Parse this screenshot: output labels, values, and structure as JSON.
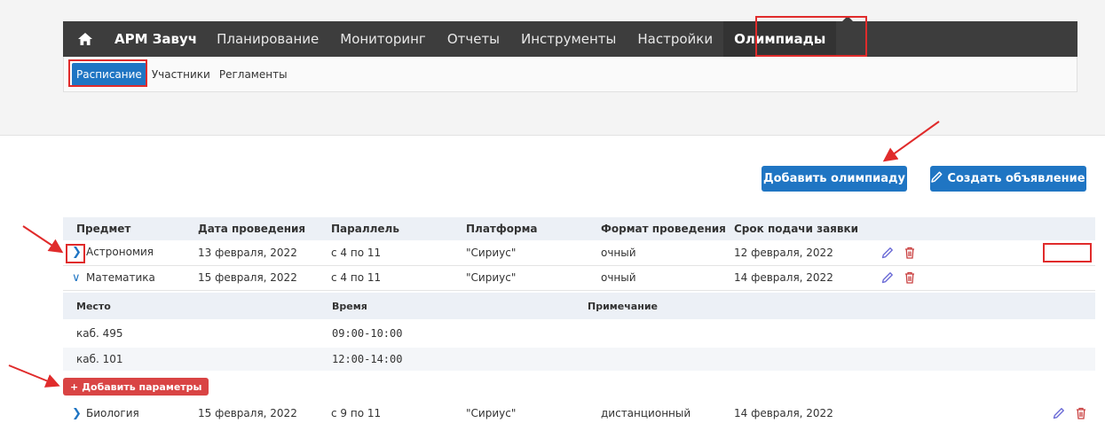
{
  "navbar": {
    "brand": "АРМ Завуч",
    "items": [
      "Планирование",
      "Мониторинг",
      "Отчеты",
      "Инструменты",
      "Настройки"
    ],
    "active": "Олимпиады"
  },
  "subnav": {
    "items": [
      "Расписание",
      "Участники",
      "Регламенты"
    ]
  },
  "buttons": {
    "add_olympiad": "Добавить олимпиаду",
    "create_announcement": "Создать объявление",
    "add_params": "Добавить параметры"
  },
  "table": {
    "headers": [
      "Предмет",
      "Дата проведения",
      "Параллель",
      "Платформа",
      "Формат проведения",
      "Срок подачи заявки"
    ],
    "rows": [
      [
        "Астрономия",
        "13 февраля, 2022",
        "с 4 по 11",
        "\"Сириус\"",
        "очный",
        "12 февраля, 2022"
      ],
      [
        "Математика",
        "15 февраля, 2022",
        "с 4 по 11",
        "\"Сириус\"",
        "очный",
        "14 февраля, 2022"
      ],
      [
        "Биология",
        "15 февраля, 2022",
        "с 9 по 11",
        "\"Сириус\"",
        "дистанционный",
        "14 февраля, 2022"
      ]
    ]
  },
  "subtable": {
    "headers": [
      "Место",
      "Время",
      "Примечание"
    ],
    "rows": [
      [
        "каб. 495",
        "09:00-10:00",
        ""
      ],
      [
        "каб. 101",
        "12:00-14:00",
        ""
      ]
    ]
  },
  "colors": {
    "accent": "#1f75c3",
    "danger": "#d94444",
    "highlight": "#e02b2b",
    "navbar": "#3d3d3d"
  }
}
